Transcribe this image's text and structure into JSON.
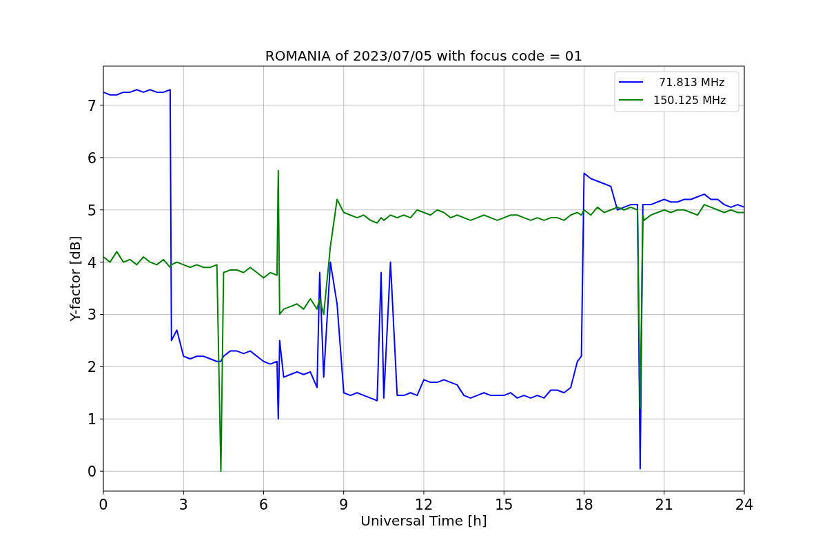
{
  "figure": {
    "chart_data": {
      "type": "line",
      "title": "ROMANIA of 2023/07/05 with focus code = 01",
      "xlabel": "Universal Time [h]",
      "ylabel": "Y-factor [dB]",
      "x": [
        0,
        0.25,
        0.5,
        0.75,
        1,
        1.25,
        1.5,
        1.75,
        2,
        2.25,
        2.5,
        2.55,
        2.75,
        3,
        3.25,
        3.5,
        3.75,
        4,
        4.25,
        4.4,
        4.5,
        4.75,
        5,
        5.25,
        5.5,
        5.75,
        6,
        6.25,
        6.5,
        6.55,
        6.6,
        6.75,
        7,
        7.25,
        7.5,
        7.75,
        8,
        8.1,
        8.25,
        8.5,
        8.75,
        9,
        9.25,
        9.5,
        9.75,
        10,
        10.25,
        10.4,
        10.5,
        10.75,
        11,
        11.25,
        11.5,
        11.75,
        12,
        12.25,
        12.5,
        12.75,
        13,
        13.25,
        13.5,
        13.75,
        14,
        14.25,
        14.5,
        14.75,
        15,
        15.25,
        15.5,
        15.75,
        16,
        16.25,
        16.5,
        16.75,
        17,
        17.25,
        17.5,
        17.75,
        17.9,
        18,
        18.25,
        18.5,
        18.75,
        19,
        19.25,
        19.5,
        19.75,
        20,
        20.1,
        20.2,
        20.25,
        20.5,
        20.75,
        21,
        21.25,
        21.5,
        21.75,
        22,
        22.25,
        22.5,
        22.75,
        23,
        23.25,
        23.5,
        23.75,
        24
      ],
      "series": [
        {
          "name": "71.813 MHz",
          "color": "#0000ff",
          "values": [
            7.25,
            7.2,
            7.2,
            7.25,
            7.25,
            7.3,
            7.25,
            7.3,
            7.25,
            7.25,
            7.3,
            2.5,
            2.7,
            2.2,
            2.15,
            2.2,
            2.2,
            2.15,
            2.1,
            2.1,
            2.2,
            2.3,
            2.3,
            2.25,
            2.3,
            2.2,
            2.1,
            2.05,
            2.1,
            1.0,
            2.5,
            1.8,
            1.85,
            1.9,
            1.85,
            1.9,
            1.6,
            3.8,
            1.8,
            4.0,
            3.2,
            1.5,
            1.45,
            1.5,
            1.45,
            1.4,
            1.35,
            3.8,
            1.4,
            4.0,
            1.45,
            1.45,
            1.5,
            1.45,
            1.75,
            1.7,
            1.7,
            1.75,
            1.7,
            1.65,
            1.45,
            1.4,
            1.45,
            1.5,
            1.45,
            1.45,
            1.45,
            1.5,
            1.4,
            1.45,
            1.4,
            1.45,
            1.4,
            1.55,
            1.55,
            1.5,
            1.6,
            2.1,
            2.2,
            5.7,
            5.6,
            5.55,
            5.5,
            5.45,
            5.0,
            5.05,
            5.1,
            5.1,
            0.05,
            5.1,
            5.1,
            5.1,
            5.15,
            5.2,
            5.15,
            5.15,
            5.2,
            5.2,
            5.25,
            5.3,
            5.2,
            5.2,
            5.1,
            5.05,
            5.1,
            5.05
          ]
        },
        {
          "name": "150.125 MHz",
          "color": "#008000",
          "values": [
            4.1,
            4.0,
            4.2,
            4.0,
            4.05,
            3.95,
            4.1,
            4.0,
            3.95,
            4.05,
            3.9,
            3.95,
            4.0,
            3.95,
            3.9,
            3.95,
            3.9,
            3.9,
            3.95,
            0.0,
            3.8,
            3.85,
            3.85,
            3.8,
            3.9,
            3.8,
            3.7,
            3.8,
            3.75,
            5.75,
            3.0,
            3.1,
            3.15,
            3.2,
            3.1,
            3.3,
            3.1,
            3.3,
            3.0,
            4.3,
            5.2,
            4.95,
            4.9,
            4.85,
            4.9,
            4.8,
            4.75,
            4.85,
            4.8,
            4.9,
            4.85,
            4.9,
            4.85,
            5.0,
            4.95,
            4.9,
            5.0,
            4.95,
            4.85,
            4.9,
            4.85,
            4.8,
            4.85,
            4.9,
            4.85,
            4.8,
            4.85,
            4.9,
            4.9,
            4.85,
            4.8,
            4.85,
            4.8,
            4.85,
            4.85,
            4.8,
            4.9,
            4.95,
            4.9,
            5.0,
            4.9,
            5.05,
            4.95,
            5.0,
            5.05,
            5.0,
            5.05,
            5.0,
            1.2,
            4.9,
            4.8,
            4.9,
            4.95,
            5.0,
            4.95,
            5.0,
            5.0,
            4.95,
            4.9,
            5.1,
            5.05,
            5.0,
            4.95,
            5.0,
            4.95,
            4.95
          ]
        }
      ],
      "grid": true,
      "legend": true,
      "xlim": [
        0,
        24
      ],
      "ylim": [
        -0.38,
        7.75
      ],
      "xticks": [
        0,
        3,
        6,
        9,
        12,
        15,
        18,
        21,
        24
      ],
      "yticks": [
        0,
        1,
        2,
        3,
        4,
        5,
        6,
        7
      ]
    }
  }
}
